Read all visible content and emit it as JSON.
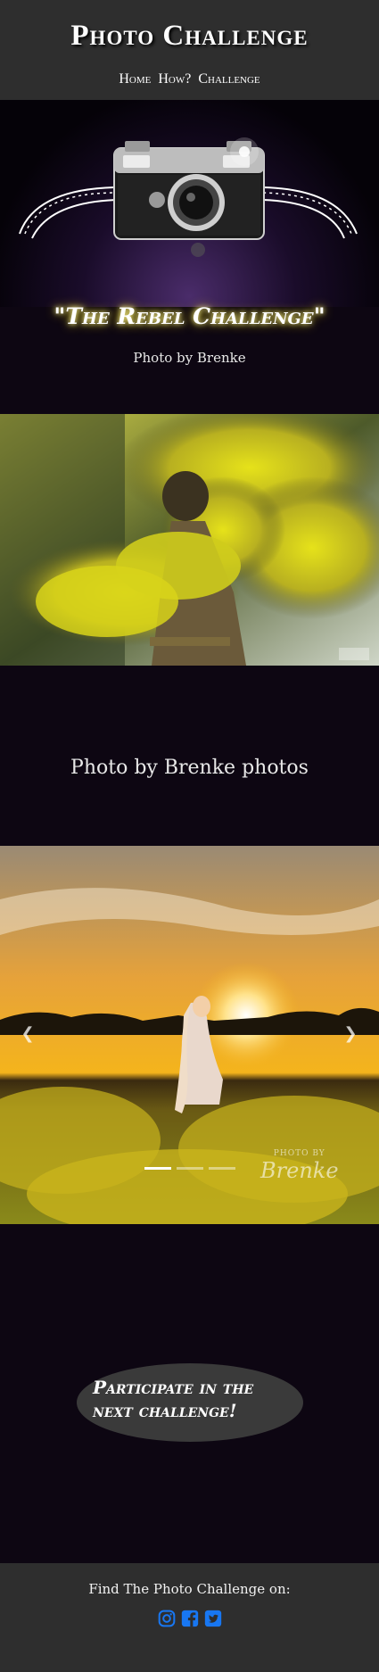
{
  "header": {
    "title": "Photo Challenge",
    "nav": [
      {
        "label": "Home"
      },
      {
        "label": "How?"
      },
      {
        "label": "Challenge"
      }
    ]
  },
  "challenge": {
    "heading": "\"The Rebel Challenge\"",
    "credit": "Photo by Brenke"
  },
  "gallery": {
    "credit": "Photo by Brenke photos",
    "prev_icon": "chevron-left-icon",
    "next_icon": "chevron-right-icon",
    "slide_count": 3,
    "active_slide": 1,
    "watermark_small": "PHOTO BY",
    "watermark_name": "Brenke"
  },
  "cta": {
    "label": "Participate in the next challenge!"
  },
  "footer": {
    "text": "Find The Photo Challenge on:",
    "social_icons": [
      "instagram-icon",
      "facebook-icon",
      "twitter-icon"
    ],
    "icon_color": "#1877f2"
  },
  "colors": {
    "header_bg": "#2e2e2e",
    "page_bg": "#0d0612",
    "glow": "#e8d400"
  }
}
